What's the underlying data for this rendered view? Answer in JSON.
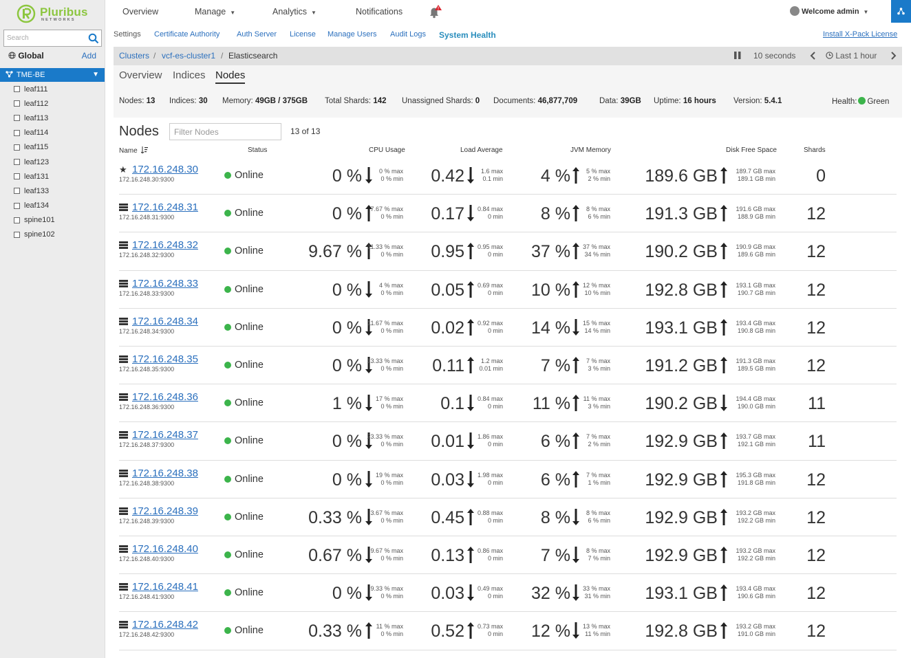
{
  "brand": {
    "name": "Pluribus",
    "sub": "NETWORKS"
  },
  "sidebar": {
    "search_placeholder": "Search",
    "global_label": "Global",
    "add_label": "Add",
    "fabric": "TME-BE",
    "switches": [
      "leaf111",
      "leaf112",
      "leaf113",
      "leaf114",
      "leaf115",
      "leaf123",
      "leaf131",
      "leaf133",
      "leaf134",
      "spine101",
      "spine102"
    ]
  },
  "topnav": {
    "overview": "Overview",
    "manage": "Manage",
    "analytics": "Analytics",
    "notifications": "Notifications",
    "welcome": "Welcome admin"
  },
  "subnav": {
    "settings": "Settings",
    "cert": "Certificate Authority",
    "auth": "Auth Server",
    "license": "License",
    "users": "Manage Users",
    "audit": "Audit Logs",
    "health": "System Health",
    "xpack": "Install X-Pack License"
  },
  "breadcrumb": {
    "clusters": "Clusters",
    "cluster": "vcf-es-cluster1",
    "current": "Elasticsearch"
  },
  "refresh": {
    "interval": "10 seconds",
    "range": "Last 1 hour"
  },
  "tabs": {
    "overview": "Overview",
    "indices": "Indices",
    "nodes": "Nodes"
  },
  "stats": {
    "nodes_label": "Nodes:",
    "nodes": "13",
    "indices_label": "Indices:",
    "indices": "30",
    "memory_label": "Memory:",
    "memory": "49GB / 375GB",
    "shards_label": "Total Shards:",
    "shards": "142",
    "unassigned_label": "Unassigned Shards:",
    "unassigned": "0",
    "docs_label": "Documents:",
    "docs": "46,877,709",
    "data_label": "Data:",
    "data": "39GB",
    "uptime_label": "Uptime:",
    "uptime": "16 hours",
    "version_label": "Version:",
    "version": "5.4.1",
    "health_label": "Health:",
    "health": "Green"
  },
  "nodes_section": {
    "title": "Nodes",
    "filter_placeholder": "Filter Nodes",
    "count": "13 of 13"
  },
  "columns": {
    "name": "Name",
    "status": "Status",
    "cpu": "CPU Usage",
    "load": "Load Average",
    "jvm": "JVM Memory",
    "disk": "Disk Free Space",
    "shards": "Shards"
  },
  "colors": {
    "accent": "#1a7ac9",
    "link": "#2a6fbd",
    "online": "#3cb44b",
    "brand": "#8cc63f"
  },
  "nodes": [
    {
      "ip": "172.16.248.30",
      "port": "172.16.248.30:9300",
      "icon": "star-icon",
      "status": "Online",
      "cpu": "0 %",
      "cpu_dir": "down",
      "cpu_max": "0 % max",
      "cpu_min": "0 % min",
      "load": "0.42",
      "load_dir": "down",
      "load_max": "1.6 max",
      "load_min": "0.1 min",
      "jvm": "4 %",
      "jvm_dir": "up",
      "jvm_max": "5 % max",
      "jvm_min": "2 % min",
      "disk": "189.6 GB",
      "disk_dir": "up",
      "disk_max": "189.7 GB max",
      "disk_min": "189.1 GB min",
      "shards": "0"
    },
    {
      "ip": "172.16.248.31",
      "port": "172.16.248.31:9300",
      "icon": "server-icon",
      "status": "Online",
      "cpu": "0 %",
      "cpu_dir": "up",
      "cpu_max": "7.67 % max",
      "cpu_min": "0 % min",
      "load": "0.17",
      "load_dir": "down",
      "load_max": "0.84 max",
      "load_min": "0 min",
      "jvm": "8 %",
      "jvm_dir": "up",
      "jvm_max": "8 % max",
      "jvm_min": "6 % min",
      "disk": "191.3 GB",
      "disk_dir": "up",
      "disk_max": "191.6 GB max",
      "disk_min": "188.9 GB min",
      "shards": "12"
    },
    {
      "ip": "172.16.248.32",
      "port": "172.16.248.32:9300",
      "icon": "server-icon",
      "status": "Online",
      "cpu": "9.67 %",
      "cpu_dir": "up",
      "cpu_max": "11.33 % max",
      "cpu_min": "0 % min",
      "load": "0.95",
      "load_dir": "up",
      "load_max": "0.95 max",
      "load_min": "0 min",
      "jvm": "37 %",
      "jvm_dir": "up",
      "jvm_max": "37 % max",
      "jvm_min": "34 % min",
      "disk": "190.2 GB",
      "disk_dir": "up",
      "disk_max": "190.9 GB max",
      "disk_min": "189.6 GB min",
      "shards": "12"
    },
    {
      "ip": "172.16.248.33",
      "port": "172.16.248.33:9300",
      "icon": "server-icon",
      "status": "Online",
      "cpu": "0 %",
      "cpu_dir": "down",
      "cpu_max": "4 % max",
      "cpu_min": "0 % min",
      "load": "0.05",
      "load_dir": "up",
      "load_max": "0.69 max",
      "load_min": "0 min",
      "jvm": "10 %",
      "jvm_dir": "up",
      "jvm_max": "12 % max",
      "jvm_min": "10 % min",
      "disk": "192.8 GB",
      "disk_dir": "up",
      "disk_max": "193.1 GB max",
      "disk_min": "190.7 GB min",
      "shards": "12"
    },
    {
      "ip": "172.16.248.34",
      "port": "172.16.248.34:9300",
      "icon": "server-icon",
      "status": "Online",
      "cpu": "0 %",
      "cpu_dir": "down",
      "cpu_max": "11.67 % max",
      "cpu_min": "0 % min",
      "load": "0.02",
      "load_dir": "up",
      "load_max": "0.92 max",
      "load_min": "0 min",
      "jvm": "14 %",
      "jvm_dir": "down",
      "jvm_max": "15 % max",
      "jvm_min": "14 % min",
      "disk": "193.1 GB",
      "disk_dir": "up",
      "disk_max": "193.4 GB max",
      "disk_min": "190.8 GB min",
      "shards": "12"
    },
    {
      "ip": "172.16.248.35",
      "port": "172.16.248.35:9300",
      "icon": "server-icon",
      "status": "Online",
      "cpu": "0 %",
      "cpu_dir": "down",
      "cpu_max": "13.33 % max",
      "cpu_min": "0 % min",
      "load": "0.11",
      "load_dir": "up",
      "load_max": "1.2 max",
      "load_min": "0.01 min",
      "jvm": "7 %",
      "jvm_dir": "up",
      "jvm_max": "7 % max",
      "jvm_min": "3 % min",
      "disk": "191.2 GB",
      "disk_dir": "up",
      "disk_max": "191.3 GB max",
      "disk_min": "189.5 GB min",
      "shards": "12"
    },
    {
      "ip": "172.16.248.36",
      "port": "172.16.248.36:9300",
      "icon": "server-icon",
      "status": "Online",
      "cpu": "1 %",
      "cpu_dir": "down",
      "cpu_max": "17 % max",
      "cpu_min": "0 % min",
      "load": "0.1",
      "load_dir": "down",
      "load_max": "0.84 max",
      "load_min": "0 min",
      "jvm": "11 %",
      "jvm_dir": "up",
      "jvm_max": "11 % max",
      "jvm_min": "3 % min",
      "disk": "190.2 GB",
      "disk_dir": "down",
      "disk_max": "194.4 GB max",
      "disk_min": "190.0 GB min",
      "shards": "11"
    },
    {
      "ip": "172.16.248.37",
      "port": "172.16.248.37:9300",
      "icon": "server-icon",
      "status": "Online",
      "cpu": "0 %",
      "cpu_dir": "down",
      "cpu_max": "23.33 % max",
      "cpu_min": "0 % min",
      "load": "0.01",
      "load_dir": "down",
      "load_max": "1.86 max",
      "load_min": "0 min",
      "jvm": "6 %",
      "jvm_dir": "up",
      "jvm_max": "7 % max",
      "jvm_min": "2 % min",
      "disk": "192.9 GB",
      "disk_dir": "up",
      "disk_max": "193.7 GB max",
      "disk_min": "192.1 GB min",
      "shards": "11"
    },
    {
      "ip": "172.16.248.38",
      "port": "172.16.248.38:9300",
      "icon": "server-icon",
      "status": "Online",
      "cpu": "0 %",
      "cpu_dir": "down",
      "cpu_max": "19 % max",
      "cpu_min": "0 % min",
      "load": "0.03",
      "load_dir": "down",
      "load_max": "1.98 max",
      "load_min": "0 min",
      "jvm": "6 %",
      "jvm_dir": "up",
      "jvm_max": "7 % max",
      "jvm_min": "1 % min",
      "disk": "192.9 GB",
      "disk_dir": "up",
      "disk_max": "195.3 GB max",
      "disk_min": "191.8 GB min",
      "shards": "12"
    },
    {
      "ip": "172.16.248.39",
      "port": "172.16.248.39:9300",
      "icon": "server-icon",
      "status": "Online",
      "cpu": "0.33 %",
      "cpu_dir": "down",
      "cpu_max": "3.67 % max",
      "cpu_min": "0 % min",
      "load": "0.45",
      "load_dir": "up",
      "load_max": "0.88 max",
      "load_min": "0 min",
      "jvm": "8 %",
      "jvm_dir": "down",
      "jvm_max": "8 % max",
      "jvm_min": "6 % min",
      "disk": "192.9 GB",
      "disk_dir": "up",
      "disk_max": "193.2 GB max",
      "disk_min": "192.2 GB min",
      "shards": "12"
    },
    {
      "ip": "172.16.248.40",
      "port": "172.16.248.40:9300",
      "icon": "server-icon",
      "status": "Online",
      "cpu": "0.67 %",
      "cpu_dir": "down",
      "cpu_max": "9.67 % max",
      "cpu_min": "0 % min",
      "load": "0.13",
      "load_dir": "up",
      "load_max": "0.86 max",
      "load_min": "0 min",
      "jvm": "7 %",
      "jvm_dir": "down",
      "jvm_max": "8 % max",
      "jvm_min": "7 % min",
      "disk": "192.9 GB",
      "disk_dir": "up",
      "disk_max": "193.2 GB max",
      "disk_min": "192.2 GB min",
      "shards": "12"
    },
    {
      "ip": "172.16.248.41",
      "port": "172.16.248.41:9300",
      "icon": "server-icon",
      "status": "Online",
      "cpu": "0 %",
      "cpu_dir": "down",
      "cpu_max": "9.33 % max",
      "cpu_min": "0 % min",
      "load": "0.03",
      "load_dir": "down",
      "load_max": "0.49 max",
      "load_min": "0 min",
      "jvm": "32 %",
      "jvm_dir": "down",
      "jvm_max": "33 % max",
      "jvm_min": "31 % min",
      "disk": "193.1 GB",
      "disk_dir": "up",
      "disk_max": "193.4 GB max",
      "disk_min": "190.6 GB min",
      "shards": "12"
    },
    {
      "ip": "172.16.248.42",
      "port": "172.16.248.42:9300",
      "icon": "server-icon",
      "status": "Online",
      "cpu": "0.33 %",
      "cpu_dir": "up",
      "cpu_max": "11 % max",
      "cpu_min": "0 % min",
      "load": "0.52",
      "load_dir": "up",
      "load_max": "0.73 max",
      "load_min": "0 min",
      "jvm": "12 %",
      "jvm_dir": "down",
      "jvm_max": "13 % max",
      "jvm_min": "11 % min",
      "disk": "192.8 GB",
      "disk_dir": "up",
      "disk_max": "193.2 GB max",
      "disk_min": "191.0 GB min",
      "shards": "12"
    }
  ]
}
